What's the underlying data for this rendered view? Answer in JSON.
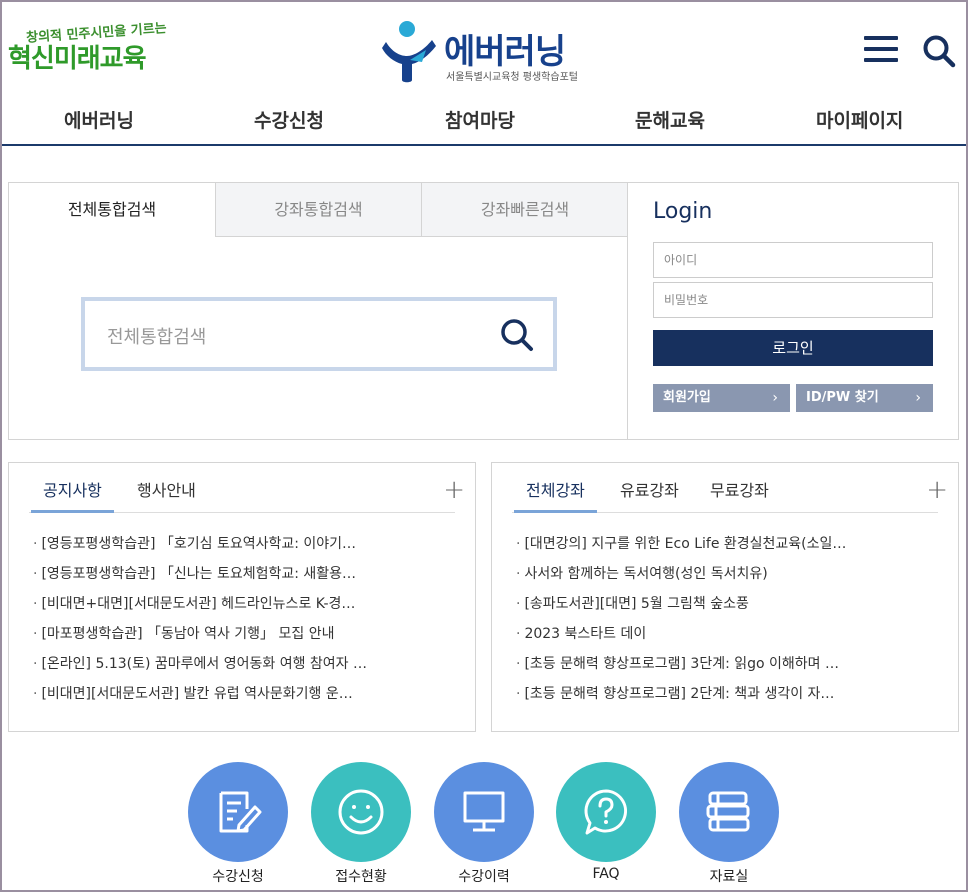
{
  "header": {
    "slogan_top": "창의적 민주시민을 기르는",
    "slogan_main": "혁신미래교육",
    "brand": "에버러닝",
    "brand_sub": "서울특별시교육청 평생학습포털",
    "nav": [
      "에버러닝",
      "수강신청",
      "참여마당",
      "문해교육",
      "마이페이지"
    ]
  },
  "search": {
    "tabs": [
      "전체통합검색",
      "강좌통합검색",
      "강좌빠른검색"
    ],
    "active_tab": "전체통합검색",
    "placeholder": "전체통합검색"
  },
  "login": {
    "title": "Login",
    "id_placeholder": "아이디",
    "pw_placeholder": "비밀번호",
    "button": "로그인",
    "signup": "회원가입",
    "find": "ID/PW 찾기"
  },
  "board_left": {
    "tabs": [
      "공지사항",
      "행사안내"
    ],
    "items": [
      "[영등포평생학습관] 「호기심 토요역사학교: 이야기…",
      "[영등포평생학습관] 「신나는 토요체험학교: 새활용…",
      "[비대면+대면][서대문도서관] 헤드라인뉴스로 K-경…",
      "[마포평생학습관] 「동남아 역사 기행」 모집 안내",
      "[온라인] 5.13(토) 꿈마루에서 영어동화 여행 참여자 …",
      "[비대면][서대문도서관] 발칸 유럽 역사문화기행 운…"
    ]
  },
  "board_right": {
    "tabs": [
      "전체강좌",
      "유료강좌",
      "무료강좌"
    ],
    "items": [
      "[대면강의] 지구를 위한 Eco Life 환경실천교육(소일…",
      "사서와 함께하는 독서여행(성인 독서치유)",
      "[송파도서관][대면] 5월 그림책 숲소풍",
      "2023 북스타트 데이",
      "[초등 문해력 향상프로그램] 3단계: 읽go 이해하며 …",
      "[초등 문해력 향상프로그램] 2단계: 책과 생각이 자…"
    ]
  },
  "quick_links": [
    {
      "label": "수강신청",
      "icon": "edit-document-icon",
      "color": "#5b8fe0"
    },
    {
      "label": "접수현황",
      "icon": "smiley-icon",
      "color": "#3bbfbf"
    },
    {
      "label": "수강이력",
      "icon": "monitor-icon",
      "color": "#5b8fe0"
    },
    {
      "label": "FAQ",
      "icon": "question-bubble-icon",
      "color": "#3bbfbf"
    },
    {
      "label": "자료실",
      "icon": "books-icon",
      "color": "#5b8fe0"
    }
  ]
}
